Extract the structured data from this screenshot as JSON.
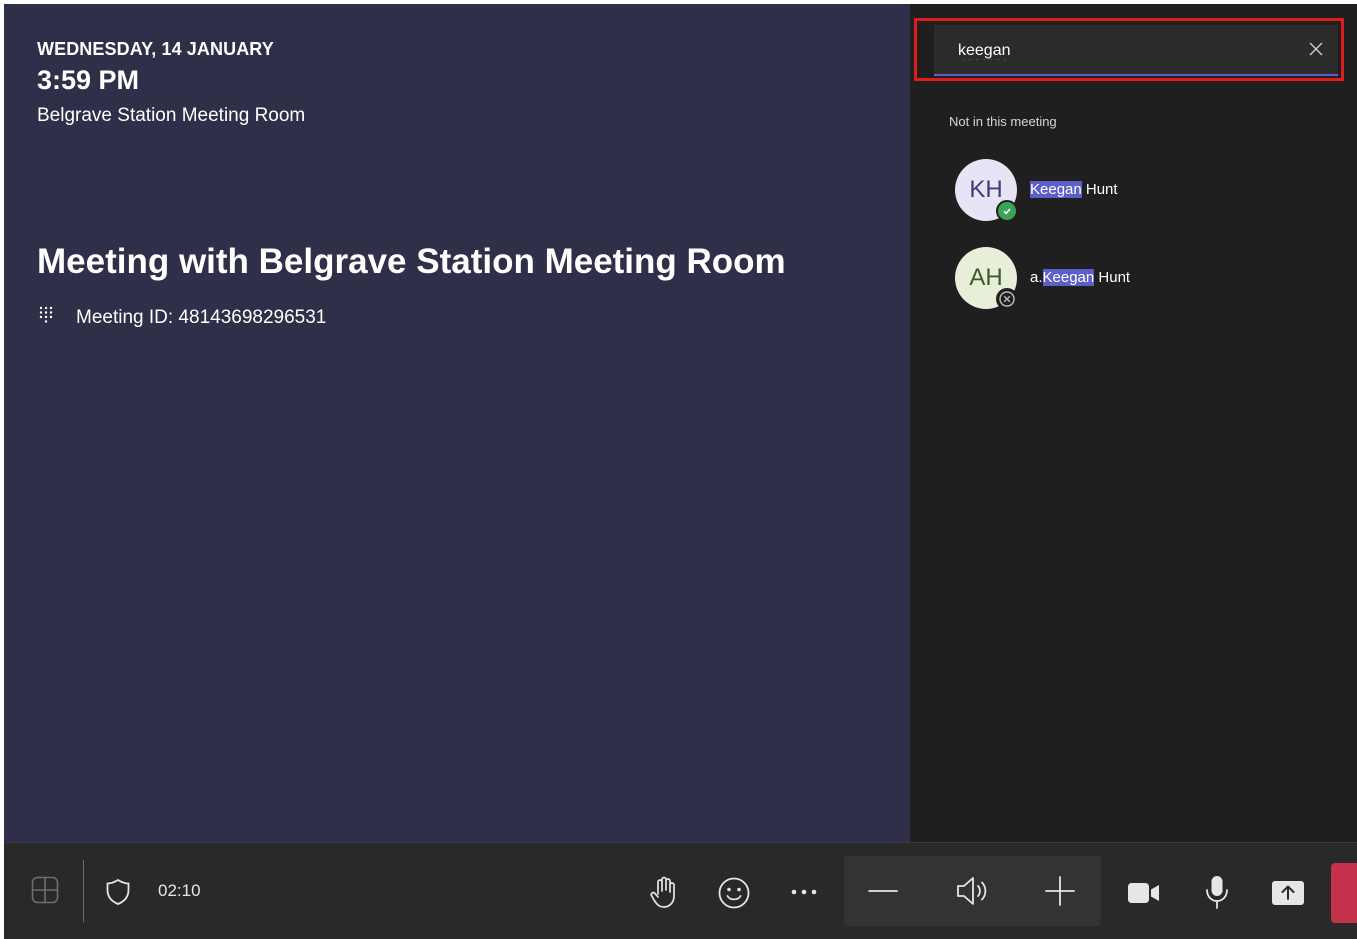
{
  "meeting": {
    "date": "WEDNESDAY, 14 JANUARY",
    "time": "3:59 PM",
    "room": "Belgrave Station Meeting Room",
    "title": "Meeting with Belgrave Station Meeting Room",
    "meeting_id": "Meeting ID: 48143698296531"
  },
  "people_search": {
    "query": "keegan",
    "section_label": "Not in this meeting",
    "results": [
      {
        "initials": "KH",
        "name_prefix": "",
        "name_match": "Keegan",
        "name_suffix": " Hunt",
        "status": "available"
      },
      {
        "initials": "AH",
        "name_prefix": "a.",
        "name_match": "Keegan",
        "name_suffix": " Hunt",
        "status": "offline"
      }
    ]
  },
  "toolbar": {
    "call_timer": "02:10",
    "icons": [
      "layout-icon",
      "shield-icon",
      "raise-hand-icon",
      "reactions-icon",
      "more-icon",
      "volume-down-icon",
      "speaker-icon",
      "volume-up-icon",
      "camera-icon",
      "mic-icon",
      "share-icon",
      "leave-icon"
    ]
  },
  "colors": {
    "meeting_bg": "#2f2f4a",
    "panel_bg": "#1f1f1f",
    "accent": "#5b5fc7",
    "highlight_box": "#e01b1b",
    "available": "#3aa356",
    "leave": "#c4314b"
  }
}
